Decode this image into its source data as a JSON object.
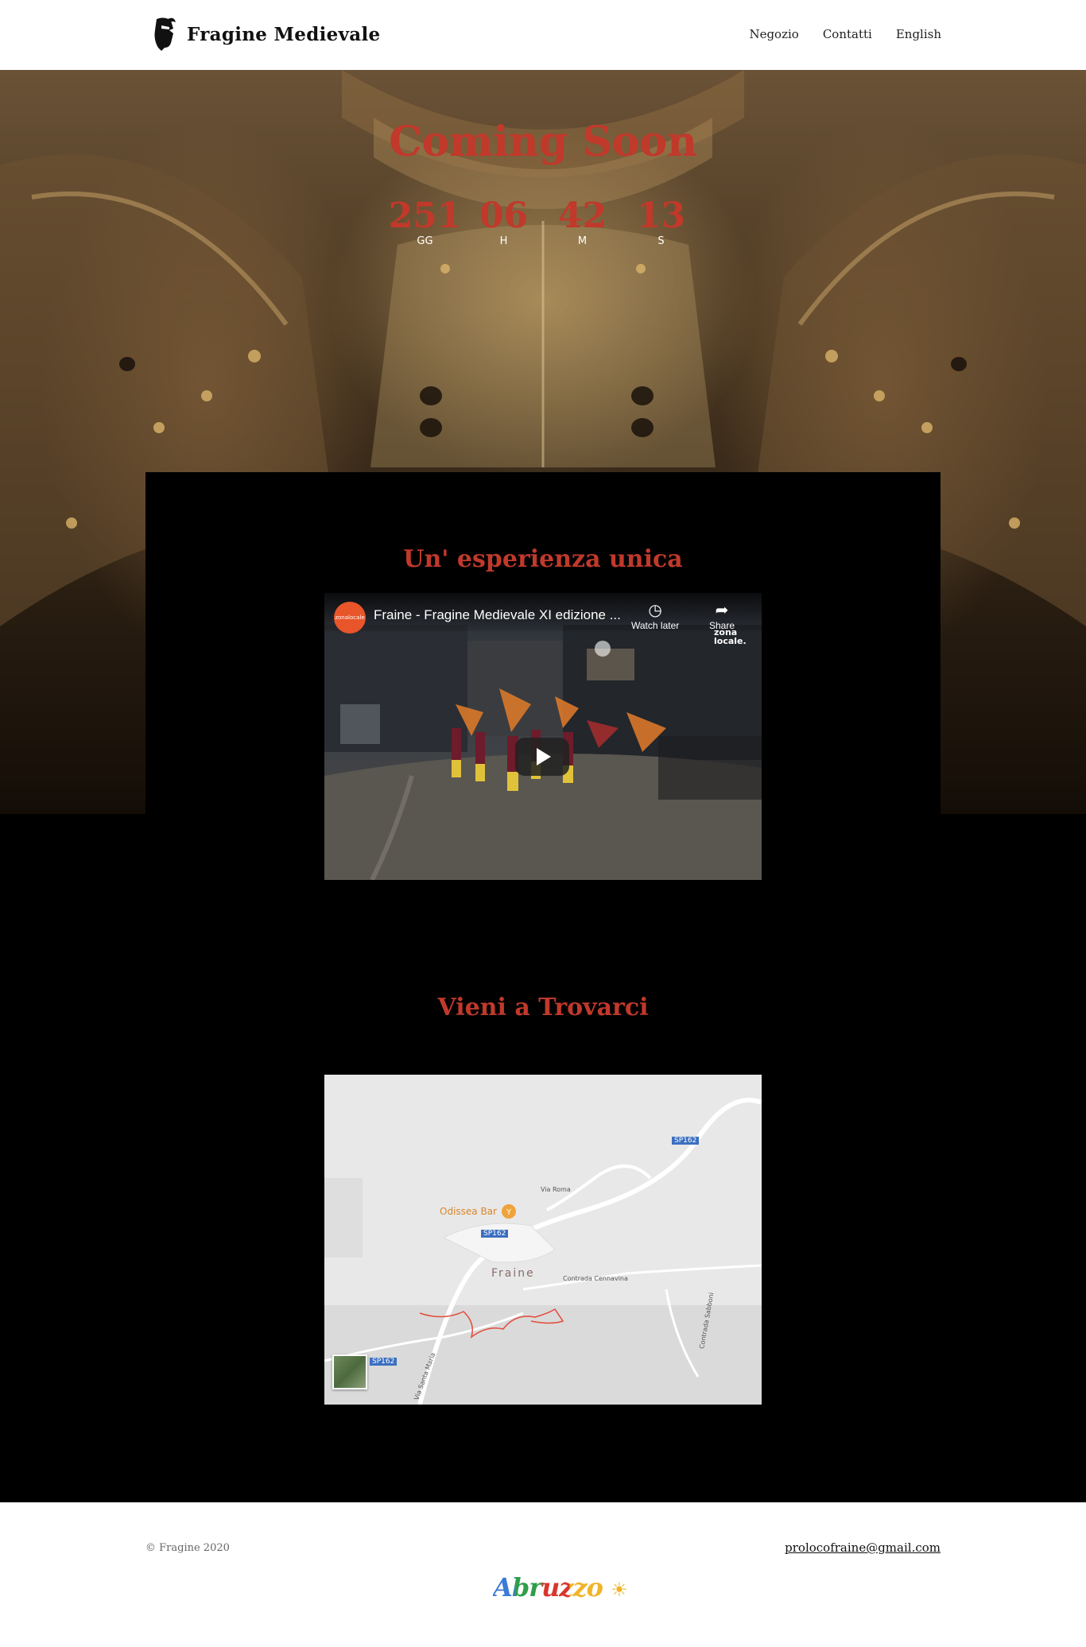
{
  "header": {
    "brand": "Fragine Medievale",
    "nav": [
      "Negozio",
      "Contatti",
      "English"
    ]
  },
  "hero": {
    "title": "Coming Soon",
    "countdown": [
      {
        "value": "251",
        "label": "GG"
      },
      {
        "value": "06",
        "label": "H"
      },
      {
        "value": "42",
        "label": "M"
      },
      {
        "value": "13",
        "label": "S"
      }
    ]
  },
  "section1": {
    "title": "Un' esperienza unica",
    "video": {
      "channel": "zonalocale",
      "title": "Fraine - Fragine Medievale XI edizione ...",
      "watch_later": "Watch later",
      "share": "Share",
      "watermark": "zona locale."
    }
  },
  "section2": {
    "title": "Vieni a Trovarci",
    "map": {
      "place": "Fraine",
      "poi": "Odissea Bar",
      "roads": [
        "SP162",
        "SP162",
        "SP162",
        "Via Roma",
        "Contrada Cennavina",
        "Via Santa Maria",
        "Contrada Sabboni"
      ]
    }
  },
  "footer": {
    "copyright": "© Fragine 2020",
    "email": "prolocofraine@gmail.com",
    "logo_text": "Abruzzo"
  },
  "colors": {
    "accent": "#c0392b",
    "background": "#000000"
  }
}
